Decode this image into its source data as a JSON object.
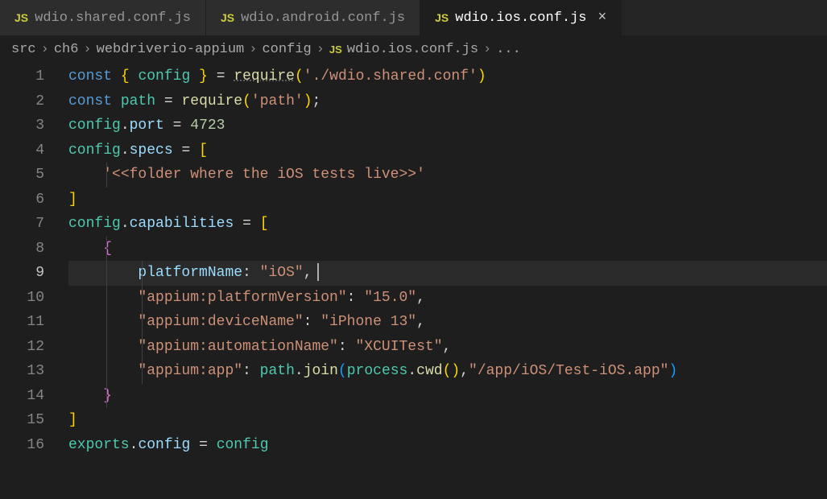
{
  "tabs": [
    {
      "label": "wdio.shared.conf.js",
      "icon": "JS",
      "active": false
    },
    {
      "label": "wdio.android.conf.js",
      "icon": "JS",
      "active": false
    },
    {
      "label": "wdio.ios.conf.js",
      "icon": "JS",
      "active": true
    }
  ],
  "breadcrumb": {
    "parts": [
      "src",
      "ch6",
      "webdriverio-appium",
      "config"
    ],
    "file_icon": "JS",
    "file": "wdio.ios.conf.js",
    "trail": "..."
  },
  "active_line": 9,
  "line_numbers": [
    "1",
    "2",
    "3",
    "4",
    "5",
    "6",
    "7",
    "8",
    "9",
    "10",
    "11",
    "12",
    "13",
    "14",
    "15",
    "16"
  ],
  "code": {
    "l1": {
      "kw": "const",
      "br_o": "{",
      "id": "config",
      "br_c": "}",
      "eq": "=",
      "fn": "require",
      "p_o": "(",
      "str": "'./wdio.shared.conf'",
      "p_c": ")"
    },
    "l2": {
      "kw": "const",
      "id": "path",
      "eq": "=",
      "fn": "require",
      "p_o": "(",
      "str": "'path'",
      "p_c": ")",
      "semi": ";"
    },
    "l3": {
      "obj": "config",
      "dot": ".",
      "prop": "port",
      "eq": "=",
      "num": "4723"
    },
    "l4": {
      "obj": "config",
      "dot": ".",
      "prop": "specs",
      "eq": "=",
      "br": "["
    },
    "l5": {
      "str": "'<<folder where the iOS tests live>>'"
    },
    "l6": {
      "br": "]"
    },
    "l7": {
      "obj": "config",
      "dot": ".",
      "prop": "capabilities",
      "eq": "=",
      "br": "["
    },
    "l8": {
      "br": "{"
    },
    "l9": {
      "key": "platformName",
      "colon": ":",
      "str": "\"iOS\"",
      "comma": ","
    },
    "l10": {
      "key": "\"appium:platformVersion\"",
      "colon": ":",
      "str": "\"15.0\"",
      "comma": ","
    },
    "l11": {
      "key": "\"appium:deviceName\"",
      "colon": ":",
      "str": "\"iPhone 13\"",
      "comma": ","
    },
    "l12": {
      "key": "\"appium:automationName\"",
      "colon": ":",
      "str": "\"XCUITest\"",
      "comma": ","
    },
    "l13": {
      "key": "\"appium:app\"",
      "colon": ":",
      "obj": "path",
      "dot": ".",
      "fn": "join",
      "p_o": "(",
      "obj2": "process",
      "dot2": ".",
      "fn2": "cwd",
      "p2_o": "(",
      "p2_c": ")",
      "comma_in": ",",
      "str": "\"/app/iOS/Test-iOS.app\"",
      "p_c": ")"
    },
    "l14": {
      "br": "}"
    },
    "l15": {
      "br": "]"
    },
    "l16": {
      "obj": "exports",
      "dot": ".",
      "prop": "config",
      "eq": "=",
      "obj2": "config"
    }
  }
}
